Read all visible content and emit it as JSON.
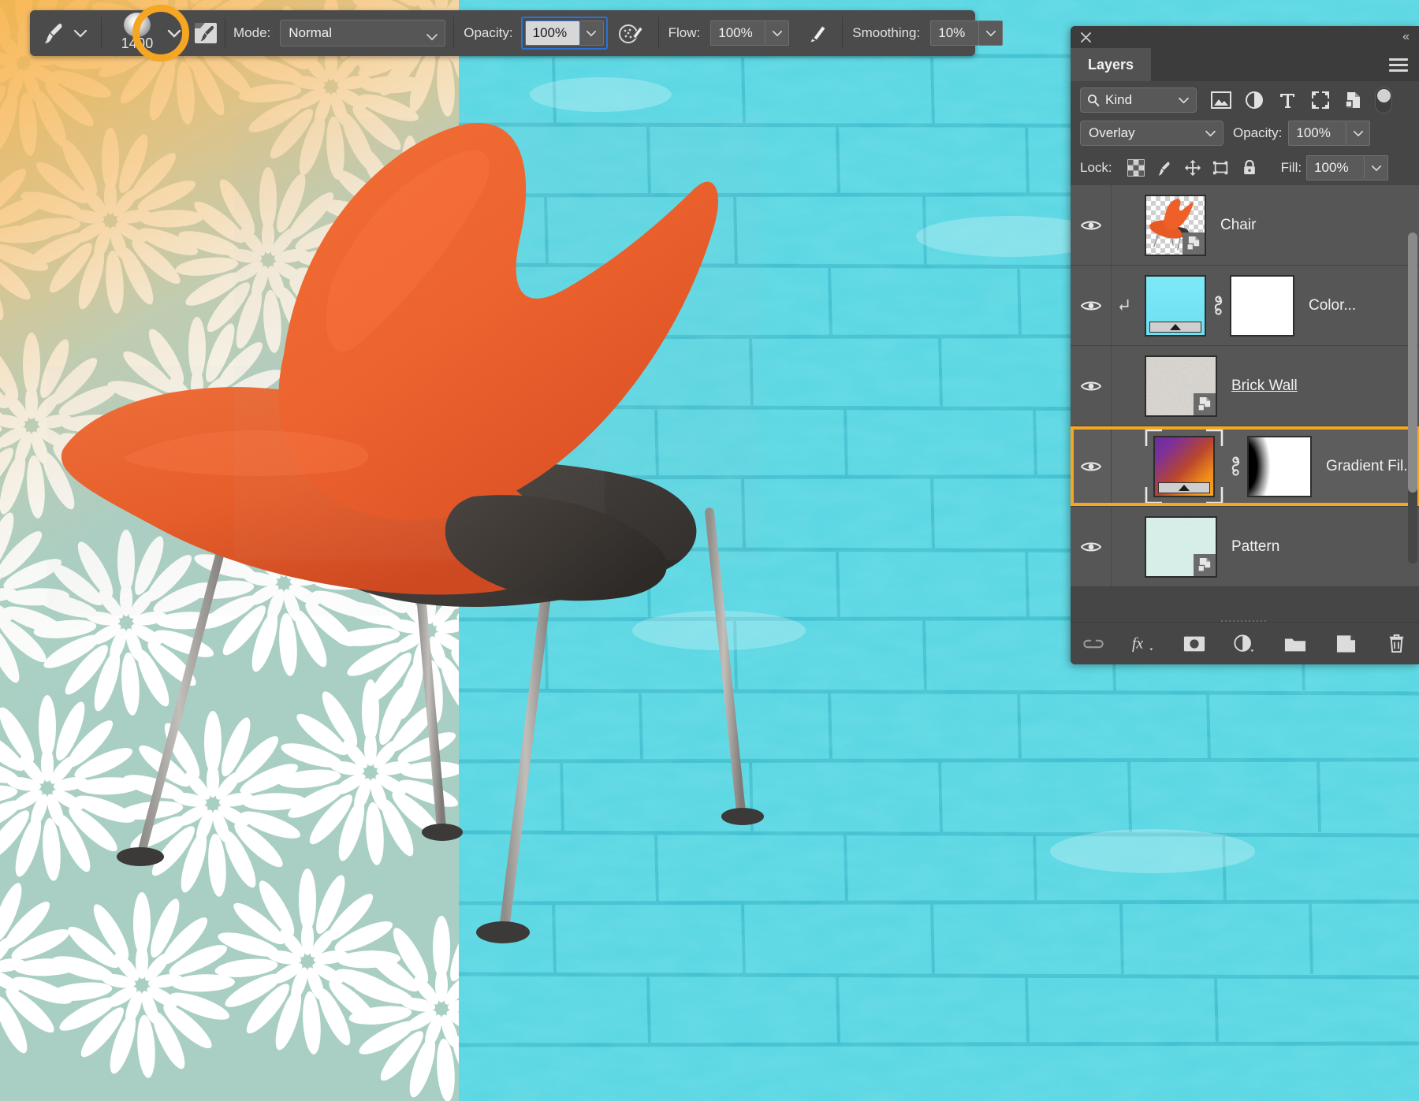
{
  "options_bar": {
    "tool_icon": "brush-icon",
    "tool_preset_chevron": "chevron-down-icon",
    "brush_size": "1400",
    "brush_picker_chevron": "chevron-down-icon",
    "brush_panel_icon": "brush-settings-icon",
    "mode_label": "Mode:",
    "mode_value": "Normal",
    "opacity_label": "Opacity:",
    "opacity_value": "100%",
    "airbrush_icon": "airbrush-icon",
    "flow_label": "Flow:",
    "flow_value": "100%",
    "smoothing_options_icon": "smoothing-options-icon",
    "smoothing_label": "Smoothing:",
    "smoothing_value": "10%"
  },
  "annotation": {
    "shape": "circle-highlight",
    "color": "#f5a623",
    "target": "brush-preset-picker-chevron"
  },
  "layers_panel": {
    "close_icon": "close-icon",
    "collapse_icon": "collapse-panel-icon",
    "tab_label": "Layers",
    "menu_icon": "panel-menu-icon",
    "filter": {
      "search_icon": "search-icon",
      "kind_label": "Kind",
      "chevron": "chevron-down-icon",
      "icons": [
        "pixel-layer-filter-icon",
        "adjustment-layer-filter-icon",
        "type-layer-filter-icon",
        "shape-layer-filter-icon",
        "smart-object-filter-icon"
      ],
      "toggle": "filter-enable-toggle"
    },
    "blend": {
      "mode_value": "Overlay",
      "mode_chevron": "chevron-down-icon",
      "opacity_label": "Opacity:",
      "opacity_value": "100%",
      "opacity_chevron": "chevron-down-icon"
    },
    "lock": {
      "label": "Lock:",
      "icons": [
        "lock-transparent-pixels-icon",
        "lock-image-pixels-icon",
        "lock-position-icon",
        "lock-artboard-nesting-icon",
        "lock-all-icon"
      ],
      "fill_label": "Fill:",
      "fill_value": "100%",
      "fill_chevron": "chevron-down-icon"
    },
    "layers": [
      {
        "name": "Chair",
        "visible": true,
        "visibility_icon": "eye-icon",
        "thumb_type": "image-transparent",
        "badge": "smart-object-badge",
        "selected": false,
        "clipped": false,
        "has_mask": false,
        "underlined": false
      },
      {
        "name": "Color...",
        "visible": true,
        "visibility_icon": "eye-icon",
        "thumb_type": "adjustment-gradient-cyan",
        "badge": null,
        "selected": false,
        "clipped": true,
        "clip_icon": "clipping-mask-arrow-icon",
        "has_mask": true,
        "mask_type": "white",
        "link_icon": "link-mask-icon",
        "underlined": false
      },
      {
        "name": "Brick Wall",
        "visible": true,
        "visibility_icon": "eye-icon",
        "thumb_type": "image-brick",
        "badge": "smart-object-badge",
        "selected": false,
        "clipped": false,
        "has_mask": false,
        "underlined": true
      },
      {
        "name": "Gradient Fil...",
        "visible": true,
        "visibility_icon": "eye-icon",
        "thumb_type": "gradient-purple-orange",
        "badge": null,
        "selected": true,
        "clipped": false,
        "has_mask": true,
        "mask_type": "black-to-white",
        "link_icon": "link-mask-icon",
        "underlined": false
      },
      {
        "name": "Pattern",
        "visible": true,
        "visibility_icon": "eye-icon",
        "thumb_type": "image-pattern",
        "badge": "smart-object-badge",
        "selected": false,
        "clipped": false,
        "has_mask": false,
        "underlined": false
      }
    ],
    "bottom_bar_icons": [
      "link-layers-icon",
      "layer-style-fx-icon",
      "add-layer-mask-icon",
      "new-adjustment-layer-icon",
      "new-group-icon",
      "new-layer-icon",
      "delete-layer-icon"
    ]
  },
  "canvas": {
    "left_panel": "floral-pattern-teal",
    "right_panel": "brick-wall-cyan",
    "subject": "orange-chair",
    "colors": {
      "pattern_teal": "#a9cfc4",
      "gradient_warm": "#f7b248",
      "brick_cyan": "#53d7e3",
      "chair_orange": "#ef5f28",
      "selection_highlight": "#f5a623"
    }
  }
}
